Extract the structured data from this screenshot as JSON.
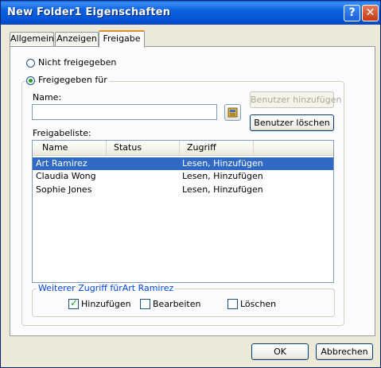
{
  "window": {
    "title": "New Folder1 Eigenschaften",
    "help_glyph": "?",
    "close_glyph": "✕"
  },
  "tabs": [
    {
      "label": "Allgemein",
      "active": false
    },
    {
      "label": "Anzeigen",
      "active": false
    },
    {
      "label": "Freigabe",
      "active": true
    }
  ],
  "sharing": {
    "option_not_shared": "Nicht freigegeben",
    "option_shared_for": "Freigegeben für",
    "selected_option": "Freigegeben für",
    "name_label": "Name:",
    "name_value": "",
    "add_user_button": "Benutzer hinzufügen",
    "add_user_enabled": false,
    "delete_user_button": "Benutzer löschen",
    "list_label": "Freigabeliste:",
    "columns": [
      "Name",
      "Status",
      "Zugriff"
    ],
    "rows": [
      {
        "name": "Art Ramirez",
        "status": "",
        "access": "Lesen, Hinzufügen",
        "selected": true
      },
      {
        "name": "Claudia Wong",
        "status": "",
        "access": "Lesen, Hinzufügen",
        "selected": false
      },
      {
        "name": "Sophie Jones",
        "status": "",
        "access": "Lesen, Hinzufügen",
        "selected": false
      }
    ]
  },
  "further_access": {
    "legend": "Weiterer Zugriff fürArt Ramirez",
    "options": [
      {
        "label": "Hinzufügen",
        "checked": true
      },
      {
        "label": "Bearbeiten",
        "checked": false
      },
      {
        "label": "Löschen",
        "checked": false
      }
    ]
  },
  "footer": {
    "ok": "OK",
    "cancel": "Abbrechen"
  },
  "colors": {
    "title_bar": "#0654d6",
    "selection": "#316ac5",
    "tab_accent": "#e68b2c"
  }
}
